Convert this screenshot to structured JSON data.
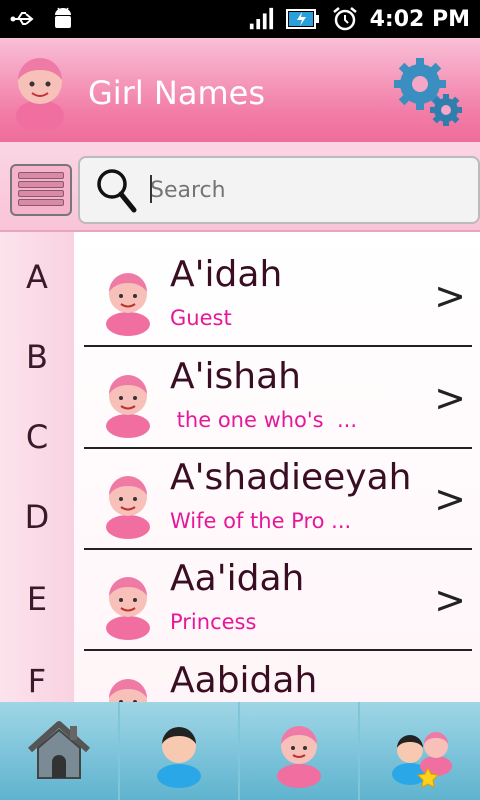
{
  "status_bar": {
    "time": "4:02 PM",
    "icons": [
      "usb-icon",
      "android-debug-icon",
      "signal-icon",
      "battery-charging-icon",
      "alarm-clock-icon"
    ]
  },
  "header": {
    "title": "Girl Names",
    "icons": [
      "girl-avatar-icon",
      "settings-gears-icon"
    ]
  },
  "search": {
    "placeholder": "Search",
    "value": ""
  },
  "index_letters": [
    "A",
    "B",
    "C",
    "D",
    "E",
    "F"
  ],
  "names": [
    {
      "name": "A'idah",
      "meaning": "Guest"
    },
    {
      "name": "A'ishah",
      "meaning": " the one who's  ..."
    },
    {
      "name": "A'shadieeyah",
      "meaning": "Wife of the Pro ..."
    },
    {
      "name": "Aa'idah",
      "meaning": "Princess"
    },
    {
      "name": "Aabidah",
      "meaning": ""
    }
  ],
  "row_chevron": ">",
  "tabs": [
    "home-icon",
    "boy-icon",
    "girl-icon",
    "favorites-icon"
  ],
  "colors": {
    "header_pink": "#f27ea8",
    "meaning_magenta": "#e6189a",
    "tabbar_blue": "#5fb3cf"
  }
}
